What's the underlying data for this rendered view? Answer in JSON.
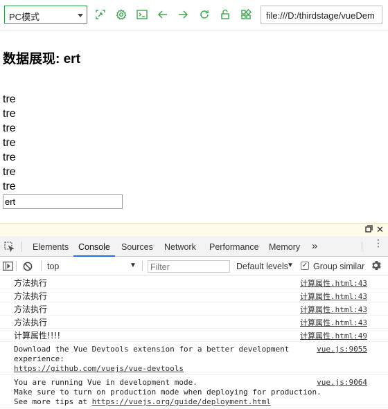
{
  "toolbar": {
    "mode_select": "PC模式",
    "url": "file:///D:/thirdstage/vueDem",
    "icons": [
      "screenshot-icon",
      "settings-icon",
      "terminal-icon",
      "back-icon",
      "forward-icon",
      "reload-icon",
      "lock-icon",
      "grid-icon"
    ]
  },
  "page": {
    "title": "数据展现: ert",
    "items": [
      "tre",
      "tre",
      "tre",
      "tre",
      "tre",
      "tre",
      "tre"
    ],
    "input_value": "ert"
  },
  "devtools": {
    "tabs": [
      "Elements",
      "Console",
      "Sources",
      "Network",
      "Performance",
      "Memory"
    ],
    "active_tab": "Console",
    "more": "»",
    "context": "top",
    "filter_placeholder": "Filter",
    "levels": "Default levels",
    "group_similar": "Group similar",
    "accent": "#1a73e8"
  },
  "console": {
    "messages": [
      {
        "text": "方法执行",
        "source": "计算属性.html:43"
      },
      {
        "text": "方法执行",
        "source": "计算属性.html:43"
      },
      {
        "text": "方法执行",
        "source": "计算属性.html:43"
      },
      {
        "text": "方法执行",
        "source": "计算属性.html:43"
      },
      {
        "text": "计算属性!!!!",
        "source": "计算属性.html:49"
      }
    ],
    "devtools_msg": {
      "line1": "Download the Vue Devtools extension for a better development",
      "line2": "experience:",
      "link": "https://github.com/vuejs/vue-devtools",
      "source": "vue.js:9055"
    },
    "dev_mode_msg": {
      "line1": "You are running Vue in development mode.",
      "line2": "Make sure to turn on production mode when deploying for production.",
      "line3_prefix": "See more tips at ",
      "link": "https://vuejs.org/guide/deployment.html",
      "source": "vue.js:9064"
    }
  }
}
